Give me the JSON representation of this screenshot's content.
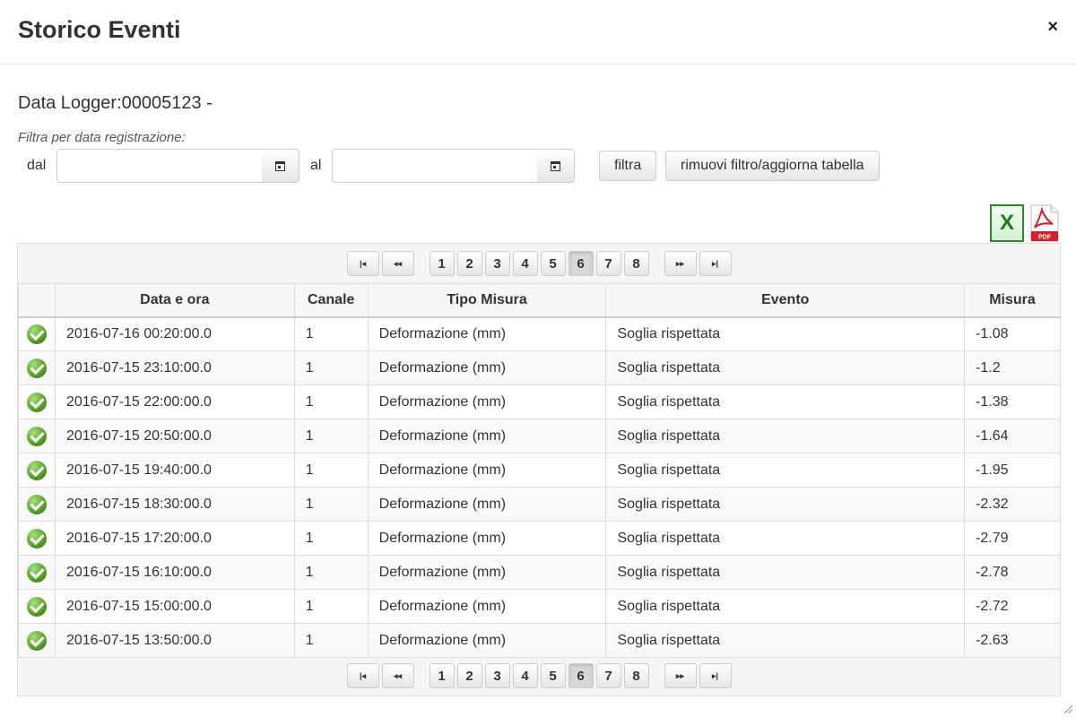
{
  "dialog": {
    "title": "Storico Eventi",
    "close_symbol": "×"
  },
  "logger": {
    "title": "Data Logger:00005123 -"
  },
  "filter": {
    "hint": "Filtra per data registrazione:",
    "from_label": "dal",
    "to_label": "al",
    "from_value": "",
    "to_value": "",
    "filter_button": "filtra",
    "reset_button": "rimuovi filtro/aggiorna tabella"
  },
  "export": {
    "excel_icon": "excel-icon",
    "pdf_icon": "pdf-icon",
    "excel_letter": "X",
    "pdf_text": "PDF"
  },
  "pager": {
    "first": "|◂",
    "prev": "◂◂",
    "next": "▸▸",
    "last": "▸|",
    "pages": [
      "1",
      "2",
      "3",
      "4",
      "5",
      "6",
      "7",
      "8"
    ],
    "current_page": "6"
  },
  "table": {
    "columns": [
      "",
      "Data e ora",
      "Canale",
      "Tipo Misura",
      "Evento",
      "Misura"
    ],
    "rows": [
      {
        "status_icon": "check-ok-icon",
        "datetime": "2016-07-16 00:20:00.0",
        "channel": "1",
        "type": "Deformazione (mm)",
        "event": "Soglia rispettata",
        "value": "-1.08"
      },
      {
        "status_icon": "check-ok-icon",
        "datetime": "2016-07-15 23:10:00.0",
        "channel": "1",
        "type": "Deformazione (mm)",
        "event": "Soglia rispettata",
        "value": "-1.2"
      },
      {
        "status_icon": "check-ok-icon",
        "datetime": "2016-07-15 22:00:00.0",
        "channel": "1",
        "type": "Deformazione (mm)",
        "event": "Soglia rispettata",
        "value": "-1.38"
      },
      {
        "status_icon": "check-ok-icon",
        "datetime": "2016-07-15 20:50:00.0",
        "channel": "1",
        "type": "Deformazione (mm)",
        "event": "Soglia rispettata",
        "value": "-1.64"
      },
      {
        "status_icon": "check-ok-icon",
        "datetime": "2016-07-15 19:40:00.0",
        "channel": "1",
        "type": "Deformazione (mm)",
        "event": "Soglia rispettata",
        "value": "-1.95"
      },
      {
        "status_icon": "check-ok-icon",
        "datetime": "2016-07-15 18:30:00.0",
        "channel": "1",
        "type": "Deformazione (mm)",
        "event": "Soglia rispettata",
        "value": "-2.32"
      },
      {
        "status_icon": "check-ok-icon",
        "datetime": "2016-07-15 17:20:00.0",
        "channel": "1",
        "type": "Deformazione (mm)",
        "event": "Soglia rispettata",
        "value": "-2.79"
      },
      {
        "status_icon": "check-ok-icon",
        "datetime": "2016-07-15 16:10:00.0",
        "channel": "1",
        "type": "Deformazione (mm)",
        "event": "Soglia rispettata",
        "value": "-2.78"
      },
      {
        "status_icon": "check-ok-icon",
        "datetime": "2016-07-15 15:00:00.0",
        "channel": "1",
        "type": "Deformazione (mm)",
        "event": "Soglia rispettata",
        "value": "-2.72"
      },
      {
        "status_icon": "check-ok-icon",
        "datetime": "2016-07-15 13:50:00.0",
        "channel": "1",
        "type": "Deformazione (mm)",
        "event": "Soglia rispettata",
        "value": "-2.63"
      }
    ]
  },
  "colors": {
    "ok_green": "#4a9a1e",
    "excel_green": "#2a8a2a",
    "pdf_red": "#d4202a",
    "active_page_bg": "#d8d8d8"
  }
}
